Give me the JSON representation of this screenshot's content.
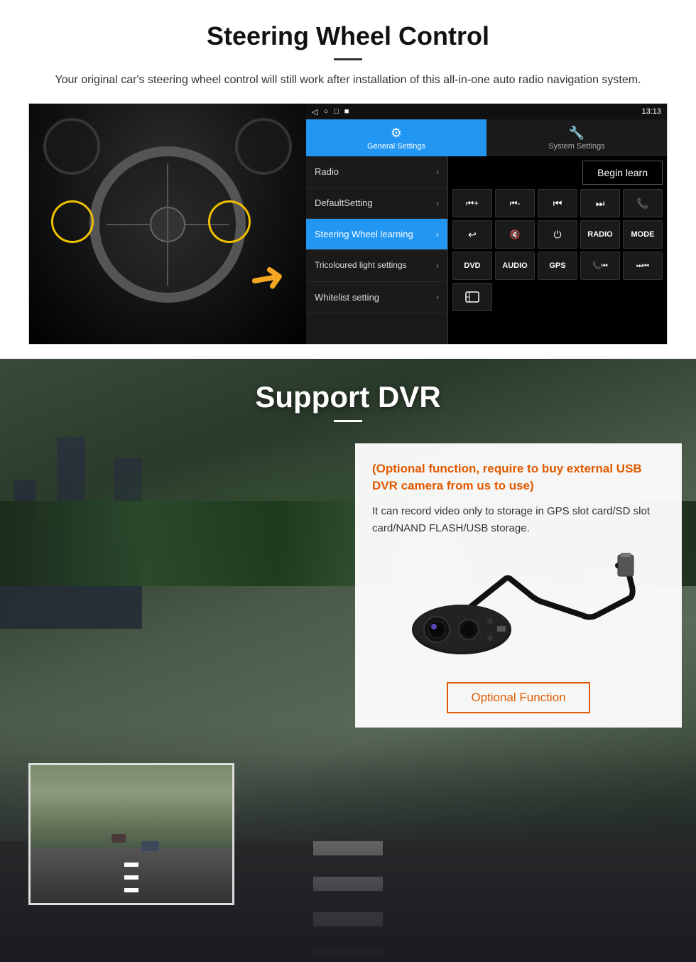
{
  "steering": {
    "title": "Steering Wheel Control",
    "description": "Your original car's steering wheel control will still work after installation of this all-in-one auto radio navigation system.",
    "status_bar": {
      "time": "13:13",
      "icons": "▲ ◀ ○ □ ■"
    },
    "tabs": {
      "general": "General Settings",
      "system": "System Settings"
    },
    "menu_items": [
      {
        "label": "Radio",
        "active": false
      },
      {
        "label": "DefaultSetting",
        "active": false
      },
      {
        "label": "Steering Wheel learning",
        "active": true
      },
      {
        "label": "Tricoloured light settings",
        "active": false
      },
      {
        "label": "Whitelist setting",
        "active": false
      }
    ],
    "begin_learn": "Begin learn",
    "control_buttons": [
      "⏮+",
      "⏮-",
      "⏮⏮",
      "⏭⏭",
      "📞",
      "↩",
      "🔇",
      "⏻",
      "RADIO",
      "MODE",
      "DVD",
      "AUDIO",
      "GPS",
      "📞⏮",
      "⏭⏮"
    ]
  },
  "dvr": {
    "title": "Support DVR",
    "optional_text": "(Optional function, require to buy external USB DVR camera from us to use)",
    "description": "It can record video only to storage in GPS slot card/SD slot card/NAND FLASH/USB storage.",
    "optional_function_btn": "Optional Function"
  }
}
